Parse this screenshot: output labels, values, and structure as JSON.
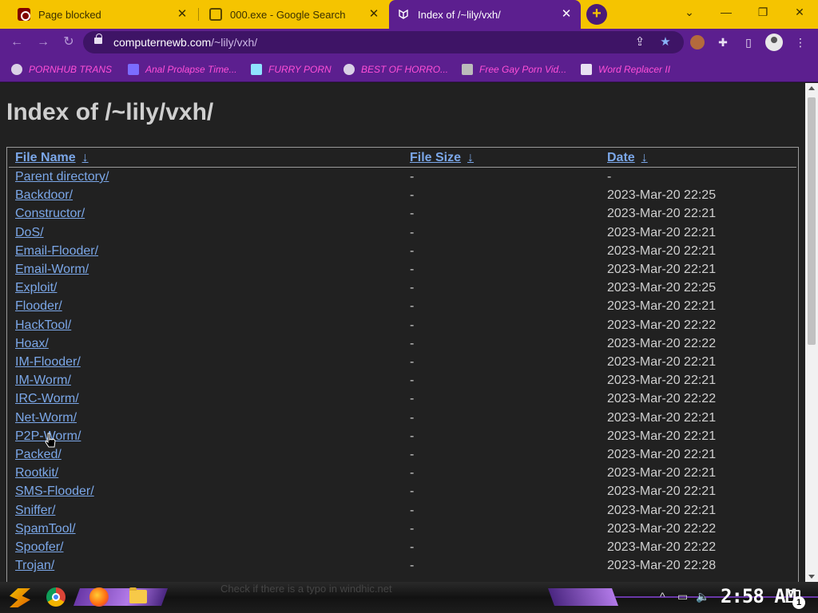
{
  "tabs": [
    {
      "title": "Page blocked",
      "favicon": "ublock-icon"
    },
    {
      "title": "000.exe - Google Search",
      "favicon": "google-icon"
    },
    {
      "title": "Index of /~lily/vxh/",
      "favicon": "index-icon",
      "active": true
    }
  ],
  "new_tab_label": "+",
  "address_bar": {
    "host": "computernewb.com",
    "path": "/~lily/vxh/"
  },
  "bookmarks": [
    {
      "label": "PORNHUB TRANS",
      "icon": "globe-icon"
    },
    {
      "label": "Anal Prolapse Time...",
      "icon": "bookmark-icon"
    },
    {
      "label": "FURRY PORN",
      "icon": "bookmark-icon"
    },
    {
      "label": "BEST OF HORRO...",
      "icon": "globe-icon"
    },
    {
      "label": "Free Gay Porn Vid...",
      "icon": "bookmark-icon"
    },
    {
      "label": "Word Replacer II",
      "icon": "extension-icon"
    }
  ],
  "page": {
    "title": "Index of /~lily/vxh/",
    "headers": {
      "name": "File Name",
      "size": "File Size",
      "date": "Date",
      "sort_arrow": "↓"
    },
    "rows": [
      {
        "name": "Parent directory/",
        "size": "-",
        "date": "-"
      },
      {
        "name": "Backdoor/",
        "size": "-",
        "date": "2023-Mar-20 22:25"
      },
      {
        "name": "Constructor/",
        "size": "-",
        "date": "2023-Mar-20 22:21"
      },
      {
        "name": "DoS/",
        "size": "-",
        "date": "2023-Mar-20 22:21"
      },
      {
        "name": "Email-Flooder/",
        "size": "-",
        "date": "2023-Mar-20 22:21"
      },
      {
        "name": "Email-Worm/",
        "size": "-",
        "date": "2023-Mar-20 22:21"
      },
      {
        "name": "Exploit/",
        "size": "-",
        "date": "2023-Mar-20 22:25"
      },
      {
        "name": "Flooder/",
        "size": "-",
        "date": "2023-Mar-20 22:21"
      },
      {
        "name": "HackTool/",
        "size": "-",
        "date": "2023-Mar-20 22:22"
      },
      {
        "name": "Hoax/",
        "size": "-",
        "date": "2023-Mar-20 22:22"
      },
      {
        "name": "IM-Flooder/",
        "size": "-",
        "date": "2023-Mar-20 22:21"
      },
      {
        "name": "IM-Worm/",
        "size": "-",
        "date": "2023-Mar-20 22:21"
      },
      {
        "name": "IRC-Worm/",
        "size": "-",
        "date": "2023-Mar-20 22:22"
      },
      {
        "name": "Net-Worm/",
        "size": "-",
        "date": "2023-Mar-20 22:21"
      },
      {
        "name": "P2P-Worm/",
        "size": "-",
        "date": "2023-Mar-20 22:21"
      },
      {
        "name": "Packed/",
        "size": "-",
        "date": "2023-Mar-20 22:21"
      },
      {
        "name": "Rootkit/",
        "size": "-",
        "date": "2023-Mar-20 22:21"
      },
      {
        "name": "SMS-Flooder/",
        "size": "-",
        "date": "2023-Mar-20 22:21"
      },
      {
        "name": "Sniffer/",
        "size": "-",
        "date": "2023-Mar-20 22:21"
      },
      {
        "name": "SpamTool/",
        "size": "-",
        "date": "2023-Mar-20 22:22"
      },
      {
        "name": "Spoofer/",
        "size": "-",
        "date": "2023-Mar-20 22:22"
      },
      {
        "name": "Trojan/",
        "size": "-",
        "date": "2023-Mar-20 22:28"
      }
    ]
  },
  "taskbar": {
    "search_hint": "Check if there is a typo in windhic.net",
    "clock": "2:58 AM",
    "notification_count": "1"
  },
  "colors": {
    "tab_strip": "#f5c400",
    "toolbar": "#5c1f8f",
    "bookmark_text": "#ff4fd8",
    "link": "#7ba7e8",
    "page_bg": "#212121"
  }
}
